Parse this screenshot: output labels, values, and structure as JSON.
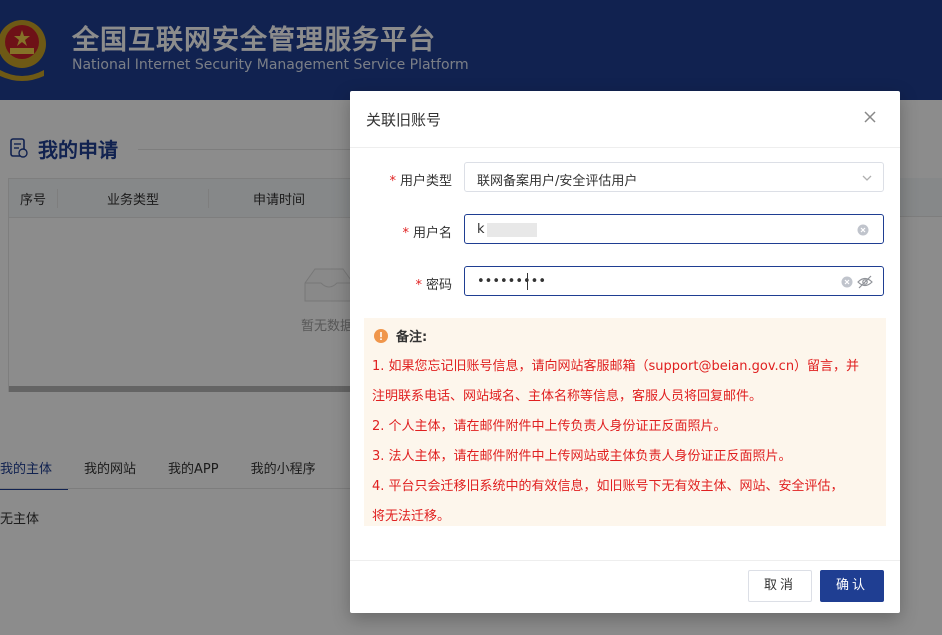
{
  "header": {
    "title_cn": "全国互联网安全管理服务平台",
    "title_en": "National Internet Security Management Service Platform"
  },
  "page": {
    "section_title": "我的申请",
    "table": {
      "headers": [
        "序号",
        "业务类型",
        "申请时间"
      ],
      "empty_text": "暂无数据"
    },
    "tabs": [
      "我的主体",
      "我的网站",
      "我的APP",
      "我的小程序"
    ],
    "active_tab": "我的主体",
    "no_subject_text": "无主体"
  },
  "dialog": {
    "title": "关联旧账号",
    "required_mark": "*",
    "fields": {
      "user_type": {
        "label": "用户类型",
        "value": "联网备案用户/安全评估用户"
      },
      "username": {
        "label": "用户名",
        "value": "k"
      },
      "password": {
        "label": "密码",
        "value": "•••••••••"
      }
    },
    "notes": {
      "heading": "备注:",
      "lines": [
        "1. 如果您忘记旧账号信息，请向网站客服邮箱（support@beian.gov.cn）留言，并",
        "注明联系电话、网站域名、主体名称等信息，客服人员将回复邮件。",
        "2. 个人主体，请在邮件附件中上传负责人身份证正反面照片。",
        "3. 法人主体，请在邮件附件中上传网站或主体负责人身份证正反面照片。",
        "4. 平台只会迁移旧系统中的有效信息，如旧账号下无有效主体、网站、安全评估，",
        "将无法迁移。"
      ]
    },
    "buttons": {
      "cancel": "取消",
      "confirm": "确认"
    }
  },
  "colors": {
    "brand": "#1f3e92",
    "required": "#e02020",
    "notes_bg": "#fdf6ec",
    "warning_icon": "#f0964b"
  },
  "icons": [
    "emblem-icon",
    "document-icon",
    "empty-box-icon",
    "close-icon",
    "chevron-down-icon",
    "clear-icon",
    "eye-off-icon",
    "warning-icon"
  ]
}
